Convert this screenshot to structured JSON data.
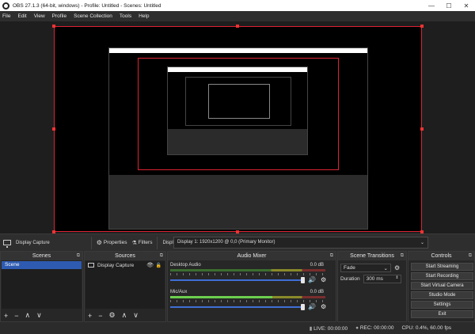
{
  "window": {
    "title": "OBS 27.1.3 (64-bit, windows) - Profile: Untitled - Scenes: Untitled"
  },
  "menu": [
    "File",
    "Edit",
    "View",
    "Profile",
    "Scene Collection",
    "Tools",
    "Help"
  ],
  "source_toolbar": {
    "selected_source": "Display Capture",
    "properties_label": "Properties",
    "filters_label": "Filters",
    "display_label": "Display",
    "display_value": "Display 1: 1920x1200 @ 0,0 (Primary Monitor)"
  },
  "docks": {
    "scenes": {
      "title": "Scenes",
      "items": [
        "Scene"
      ]
    },
    "sources": {
      "title": "Sources",
      "items": [
        "Display Capture"
      ]
    },
    "mixer": {
      "title": "Audio Mixer",
      "tracks": [
        {
          "name": "Desktop Audio",
          "db": "0.0 dB",
          "level": 0.0
        },
        {
          "name": "Mic/Aux",
          "db": "0.0 dB",
          "level": 0.66
        }
      ]
    },
    "transitions": {
      "title": "Scene Transitions",
      "type": "Fade",
      "duration_label": "Duration",
      "duration_value": "300 ms"
    },
    "controls": {
      "title": "Controls",
      "buttons": [
        "Start Streaming",
        "Start Recording",
        "Start Virtual Camera",
        "Studio Mode",
        "Settings",
        "Exit"
      ]
    }
  },
  "status": {
    "live": "LIVE: 00:00:00",
    "rec": "REC: 00:00:00",
    "cpu": "CPU: 0.4%, 60.00 fps"
  }
}
